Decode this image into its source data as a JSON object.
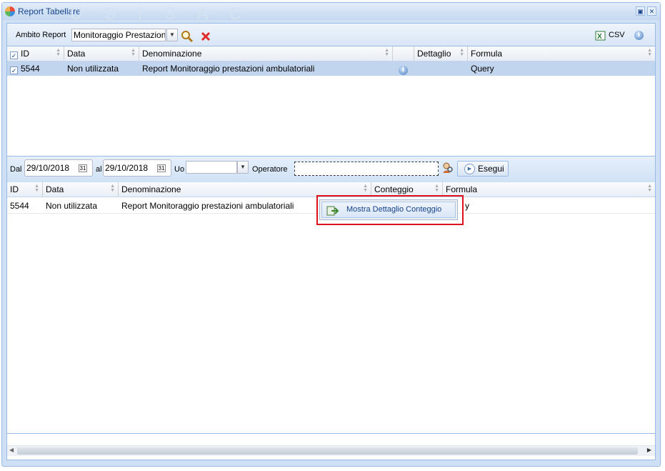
{
  "window": {
    "title": "Report Tabellare",
    "watermark": "U S I S A C"
  },
  "toolbar": {
    "ambito_label": "Ambito Report",
    "ambito_value": "Monitoraggio Prestazion",
    "csv_label": "CSV"
  },
  "top_grid": {
    "headers": [
      "ID",
      "Data",
      "Denominazione",
      "Dettaglio",
      "Formula"
    ],
    "rows": [
      {
        "checked": true,
        "id": "5544",
        "data": "Non utilizzata",
        "denominazione": "Report Monitoraggio prestazioni ambulatoriali",
        "formula": "Query"
      }
    ]
  },
  "filter": {
    "dal_label": "Dal",
    "dal_value": "29/10/2018",
    "al_label": "al",
    "al_value": "29/10/2018",
    "uo_label": "Uo",
    "uo_value": "",
    "operatore_label": "Operatore",
    "operatore_value": "",
    "esegui_label": "Esegui"
  },
  "bottom_grid": {
    "headers": [
      "ID",
      "Data",
      "Denominazione",
      "Conteggio",
      "Formula"
    ],
    "rows": [
      {
        "id": "5544",
        "data": "Non utilizzata",
        "denominazione": "Report Monitoraggio prestazioni ambulatoriali",
        "formula_partial": "y"
      }
    ]
  },
  "context_menu": {
    "item_label": "Mostra Dettaglio Conteggio"
  },
  "colors": {
    "selected_row": "#c2d5ee",
    "highlight_box": "#e0101e",
    "filter_bar": "#d6e6f7"
  }
}
